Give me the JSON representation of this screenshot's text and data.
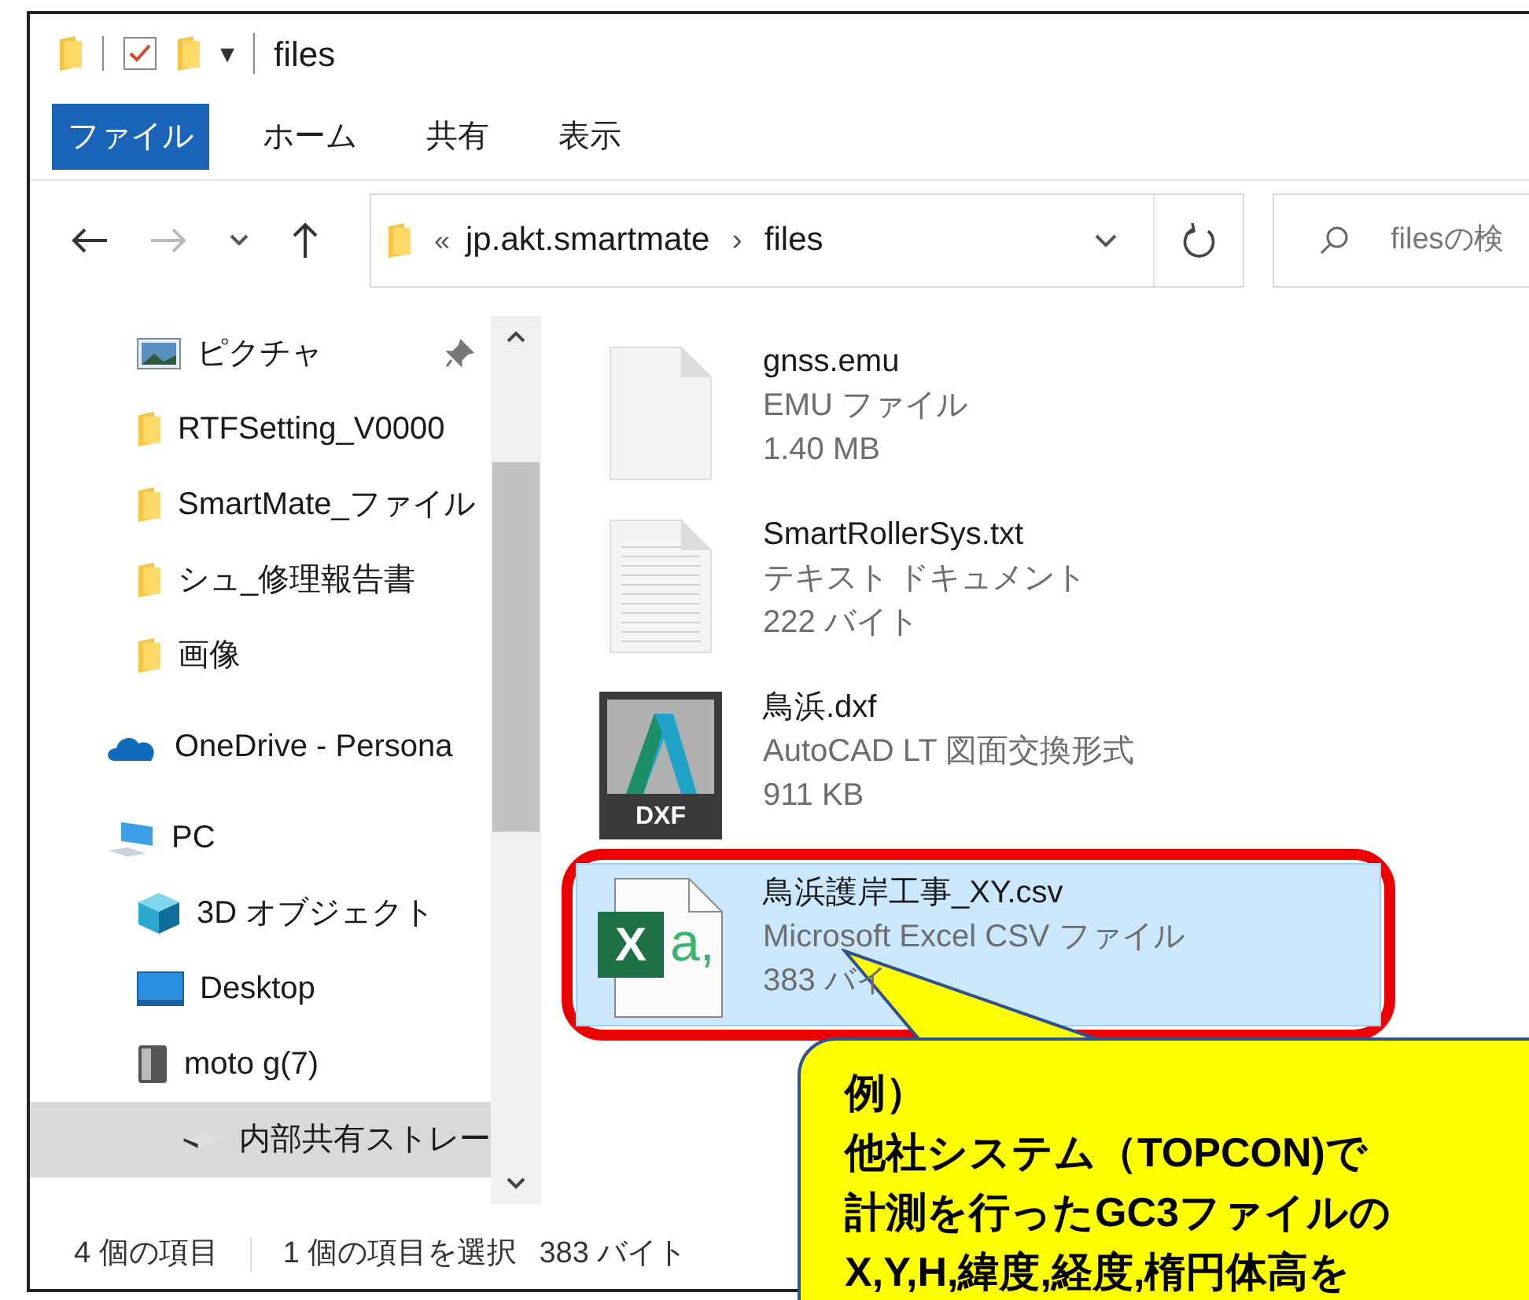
{
  "window": {
    "title": "files",
    "qat_dropdown": "▾"
  },
  "ribbon": {
    "tabs": [
      {
        "label": "ファイル",
        "selected": true
      },
      {
        "label": "ホーム",
        "selected": false
      },
      {
        "label": "共有",
        "selected": false
      },
      {
        "label": "表示",
        "selected": false
      }
    ]
  },
  "address_bar": {
    "overflow": "«",
    "segments": [
      "jp.akt.smartmate",
      "files"
    ],
    "separator": "›"
  },
  "search": {
    "placeholder": "filesの検"
  },
  "sidebar": {
    "items": [
      {
        "label": "ピクチャ",
        "kind": "picture",
        "pinned": true,
        "selected": false
      },
      {
        "label": "RTFSetting_V0000",
        "kind": "folder",
        "pinned": false,
        "selected": false
      },
      {
        "label": "SmartMate_ファイル",
        "kind": "folder",
        "pinned": false,
        "selected": false
      },
      {
        "label": "シュ_修理報告書",
        "kind": "folder",
        "pinned": false,
        "selected": false
      },
      {
        "label": "画像",
        "kind": "folder",
        "pinned": false,
        "selected": false
      },
      {
        "label": "OneDrive - Persona",
        "kind": "cloud",
        "pinned": false,
        "selected": false
      },
      {
        "label": "PC",
        "kind": "pc",
        "pinned": false,
        "selected": false,
        "children": [
          {
            "label": "3D オブジェクト",
            "kind": "cube",
            "pinned": false,
            "selected": false
          },
          {
            "label": "Desktop",
            "kind": "desktop",
            "pinned": false,
            "selected": false
          },
          {
            "label": "moto g(7)",
            "kind": "device",
            "pinned": false,
            "selected": false,
            "children": [
              {
                "label": "内部共有ストレー",
                "kind": "drive",
                "pinned": false,
                "selected": true
              }
            ]
          }
        ]
      }
    ]
  },
  "files": [
    {
      "name": "gnss.emu",
      "type": "EMU ファイル",
      "size": "1.40 MB",
      "kind": "blank",
      "selected": false,
      "highlighted": false
    },
    {
      "name": "SmartRollerSys.txt",
      "type": "テキスト ドキュメント",
      "size": "222 バイト",
      "kind": "text",
      "selected": false,
      "highlighted": false
    },
    {
      "name": "鳥浜.dxf",
      "type": "AutoCAD LT 図面交換形式",
      "size": "911 KB",
      "kind": "dxf",
      "icon_label": "DXF",
      "selected": false,
      "highlighted": false
    },
    {
      "name": "鳥浜護岸工事_XY.csv",
      "type": "Microsoft Excel CSV ファイル",
      "size": "383 バイ",
      "kind": "csv",
      "icon_label": "X",
      "icon_sub": "a,",
      "selected": true,
      "highlighted": true
    }
  ],
  "status_bar": [
    "4 個の項目",
    "1 個の項目を選択",
    "383 バイト"
  ],
  "callout": {
    "lines": [
      "例）",
      "他社システム（TOPCON)で",
      "計測を行ったGC3ファイルの",
      "X,Y,H,緯度,経度,楕円体高を"
    ]
  }
}
